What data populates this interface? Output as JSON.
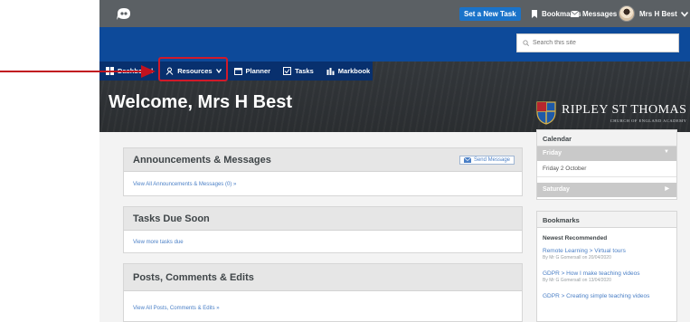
{
  "topbar": {
    "logo_icon": "app-logo-icon",
    "set_task_label": "Set a New Task",
    "bookmarks_label": "Bookmarks",
    "messages_label": "Messages",
    "user_label": "Mrs H Best",
    "accent": "#1a73c9"
  },
  "search": {
    "placeholder": "Search this site"
  },
  "nav": {
    "items": [
      {
        "label": "Dashboard",
        "icon": "grid-icon"
      },
      {
        "label": "Resources",
        "icon": "resources-icon"
      },
      {
        "label": "Planner",
        "icon": "calendar-icon"
      },
      {
        "label": "Tasks",
        "icon": "checkbox-icon"
      },
      {
        "label": "Markbook",
        "icon": "chart-icon"
      }
    ]
  },
  "hero": {
    "welcome": "Welcome, Mrs H Best",
    "school_name": "RIPLEY ST THOMAS",
    "school_sub": "CHURCH OF ENGLAND ACADEMY"
  },
  "announcements": {
    "title": "Announcements & Messages",
    "send_label": "Send Message",
    "link": "View All Announcements & Messages (0) »"
  },
  "tasks": {
    "title": "Tasks Due Soon",
    "link": "View more tasks due"
  },
  "posts": {
    "title": "Posts, Comments & Edits",
    "link": "View All Posts, Comments & Edits »"
  },
  "calendar": {
    "title": "Calendar",
    "day1": "Friday",
    "date1": "Friday 2 October",
    "day2": "Saturday"
  },
  "bookmarks": {
    "title": "Bookmarks",
    "subtitle": "Newest Recommended",
    "items": [
      {
        "title": "Remote Learning > Virtual tours",
        "meta": "By Mr G Gomersall on 20/04/2020"
      },
      {
        "title": "GDPR > How I make teaching videos",
        "meta": "By Mr G Gomersall on 13/04/2020"
      },
      {
        "title": "GDPR > Creating simple teaching videos",
        "meta": ""
      }
    ]
  },
  "colors": {
    "nav_bg": "#08306e",
    "blue_bar": "#0d4a9a",
    "highlight": "#d11a2a"
  }
}
